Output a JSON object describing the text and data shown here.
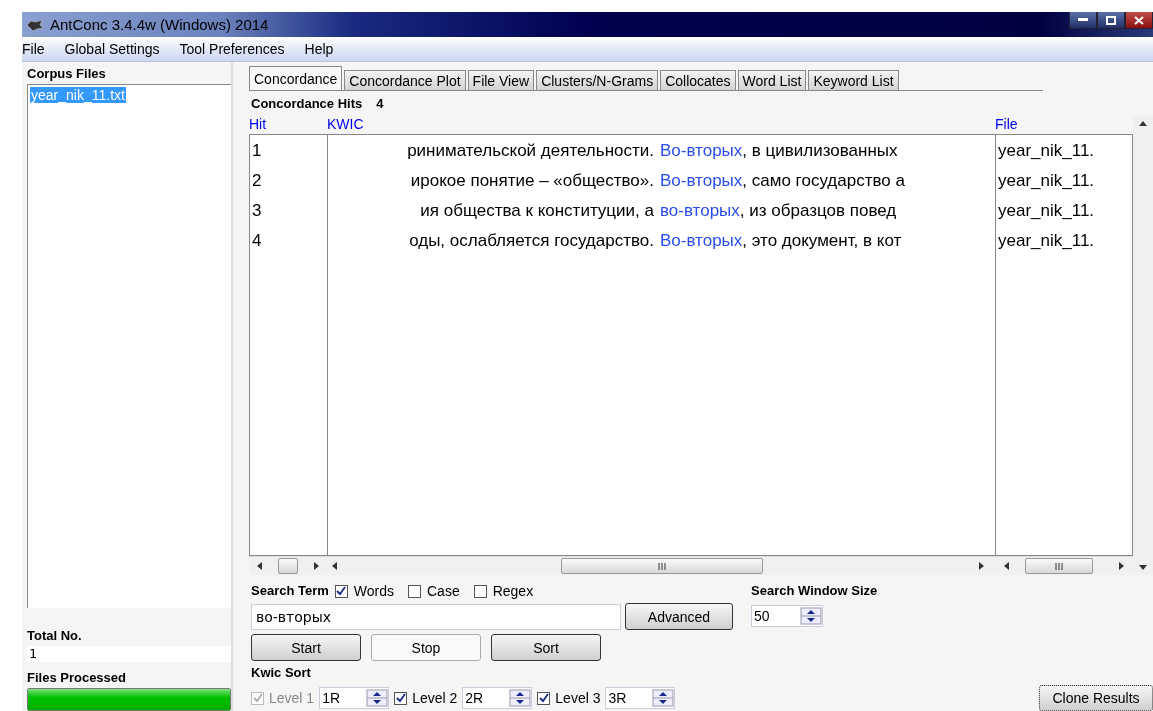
{
  "window": {
    "title": "AntConc 3.4.4w (Windows) 2014"
  },
  "menu": [
    "File",
    "Global Settings",
    "Tool Preferences",
    "Help"
  ],
  "corpus_files": {
    "label": "Corpus Files",
    "items": [
      {
        "name": "year_nik_11.txt",
        "selected": true
      }
    ]
  },
  "total": {
    "label": "Total No.",
    "value": "1"
  },
  "files_processed": {
    "label": "Files Processed",
    "level": 1
  },
  "tabs": [
    {
      "label": "Concordance",
      "selected": true
    },
    {
      "label": "Concordance Plot",
      "selected": false
    },
    {
      "label": "File View",
      "selected": false
    },
    {
      "label": "Clusters/N-Grams",
      "selected": false
    },
    {
      "label": "Collocates",
      "selected": false
    },
    {
      "label": "Word List",
      "selected": false
    },
    {
      "label": "Keyword List",
      "selected": false
    }
  ],
  "hits": {
    "label": "Concordance Hits",
    "value": "4"
  },
  "table": {
    "columns": [
      "Hit",
      "KWIC",
      "File"
    ],
    "rows": [
      {
        "hit": "1",
        "left": "ринимательской деятельности.",
        "keyword": "Во-вторых",
        "right": ", в цивилизованных",
        "file": "year_nik_11."
      },
      {
        "hit": "2",
        "left": "ирокое понятие – «общество».",
        "keyword": "Во-вторых",
        "right": ", само государство а",
        "file": "year_nik_11."
      },
      {
        "hit": "3",
        "left": "ия общества к конституции, а",
        "keyword": "во-вторых",
        "right": ", из образцов повед",
        "file": "year_nik_11."
      },
      {
        "hit": "4",
        "left": "оды, ослабляется государство.",
        "keyword": "Во-вторых",
        "right": ", это документ, в кот",
        "file": "year_nik_11."
      }
    ]
  },
  "search": {
    "label": "Search Term",
    "options": [
      {
        "label": "Words",
        "checked": true
      },
      {
        "label": "Case",
        "checked": false
      },
      {
        "label": "Regex",
        "checked": false
      }
    ],
    "value": "во-вторых",
    "advanced": "Advanced"
  },
  "window_size": {
    "label": "Search Window Size",
    "value": "50"
  },
  "buttons": [
    {
      "label": "Start",
      "disabled": false
    },
    {
      "label": "Stop",
      "disabled": true
    },
    {
      "label": "Sort",
      "disabled": false
    }
  ],
  "kwic_sort": {
    "label": "Kwic Sort",
    "levels": [
      {
        "label": "Level 1",
        "checked": true,
        "disabled": true,
        "value": "1R"
      },
      {
        "label": "Level 2",
        "checked": true,
        "disabled": false,
        "value": "2R"
      },
      {
        "label": "Level 3",
        "checked": true,
        "disabled": false,
        "value": "3R"
      }
    ]
  },
  "clone": "Clone Results"
}
